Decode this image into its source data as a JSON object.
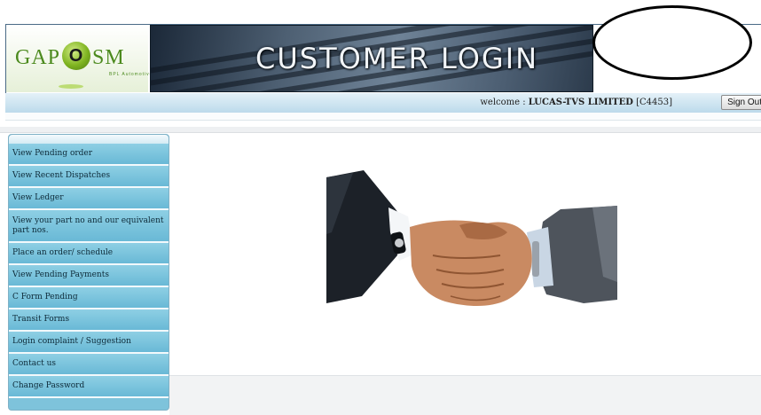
{
  "header": {
    "logo_left": "GAP",
    "logo_mid": "O",
    "logo_right": "SM",
    "logo_sub": "BPL Automotive",
    "banner_title": "CUSTOMER LOGIN"
  },
  "welcome": {
    "prefix": "welcome :",
    "company": "LUCAS-TVS LIMITED",
    "code": "[C4453]",
    "signout_label": "Sign Out"
  },
  "sidebar": {
    "items": [
      {
        "label": "View Pending order"
      },
      {
        "label": "View Recent Dispatches"
      },
      {
        "label": "View Ledger"
      },
      {
        "label": "View your part no and our equivalent part nos."
      },
      {
        "label": "Place an order/ schedule"
      },
      {
        "label": "View Pending Payments"
      },
      {
        "label": "C Form Pending"
      },
      {
        "label": "Transit Forms"
      },
      {
        "label": "Login complaint / Suggestion"
      },
      {
        "label": "Contact us"
      },
      {
        "label": "Change Password"
      }
    ]
  },
  "colors": {
    "accent": "#7ec3db",
    "brand_green": "#4c8a1e",
    "banner_dark": "#1b2838"
  },
  "icons": {
    "logo": "gaposm-logo-icon",
    "main_image": "handshake-image"
  }
}
